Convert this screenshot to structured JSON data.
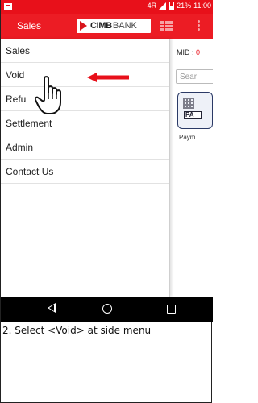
{
  "status_bar": {
    "network_label": "4R",
    "battery": "21%",
    "time": "11:00"
  },
  "app_bar": {
    "tab_label": "Sales",
    "logo_bold": "CIMB",
    "logo_light": "BANK",
    "brand_color": "#ec1c24"
  },
  "side_menu": {
    "items": [
      {
        "label": "Sales"
      },
      {
        "label": "Void"
      },
      {
        "label": "Refu"
      },
      {
        "label": "Settlement"
      },
      {
        "label": "Admin"
      },
      {
        "label": "Contact Us"
      }
    ]
  },
  "behind_content": {
    "mid_label": "MID :",
    "mid_value": "0",
    "search_placeholder": "Sear",
    "tile_badge": "PA",
    "tile_label": "Paym"
  },
  "nav_bar": {
    "back_icon": "back-triangle-icon",
    "home_icon": "home-circle-icon",
    "recent_icon": "recent-square-icon"
  },
  "caption": "2. Select <Void> at side menu"
}
